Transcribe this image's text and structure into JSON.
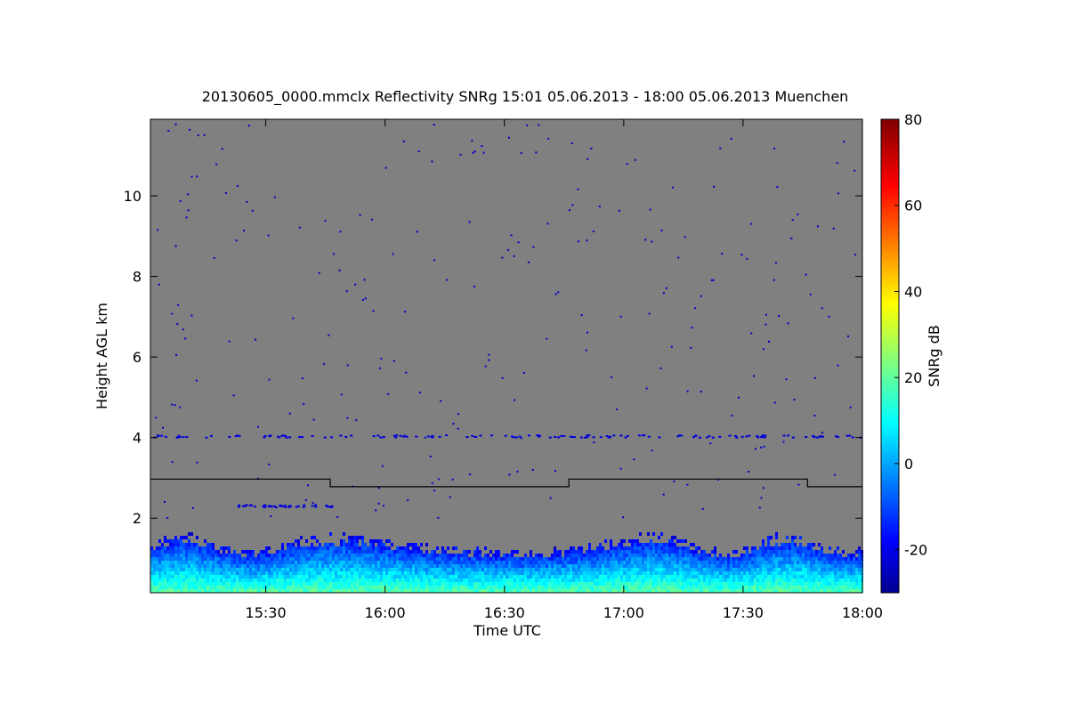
{
  "chart_data": {
    "type": "heatmap",
    "title": "20130605_0000.mmclx Reflectivity SNRg   15:01 05.06.2013 - 18:00 05.06.2013 Muenchen",
    "xlabel": "Time UTC",
    "ylabel": "Height AGL km",
    "colorbar_label": "SNRg dB",
    "x_range_hours": [
      15.0167,
      18.0
    ],
    "y_range_km": [
      0.15,
      11.9
    ],
    "x_ticks": [
      {
        "value": 15.5,
        "label": "15:30"
      },
      {
        "value": 16.0,
        "label": "16:00"
      },
      {
        "value": 16.5,
        "label": "16:30"
      },
      {
        "value": 17.0,
        "label": "17:00"
      },
      {
        "value": 17.5,
        "label": "17:30"
      },
      {
        "value": 18.0,
        "label": "18:00"
      }
    ],
    "y_ticks": [
      {
        "value": 2,
        "label": "2"
      },
      {
        "value": 4,
        "label": "4"
      },
      {
        "value": 6,
        "label": "6"
      },
      {
        "value": 8,
        "label": "8"
      },
      {
        "value": 10,
        "label": "10"
      }
    ],
    "colorbar_range": [
      -30,
      80
    ],
    "colorbar_ticks": [
      {
        "value": -20,
        "label": "-20"
      },
      {
        "value": 0,
        "label": "0"
      },
      {
        "value": 20,
        "label": "20"
      },
      {
        "value": 40,
        "label": "40"
      },
      {
        "value": 60,
        "label": "60"
      },
      {
        "value": 80,
        "label": "80"
      }
    ],
    "background_color": "#808080",
    "colormap": "jet",
    "boundary_line": [
      {
        "x": 15.0167,
        "y": 2.97
      },
      {
        "x": 15.77,
        "y": 2.97
      },
      {
        "x": 15.77,
        "y": 2.78
      },
      {
        "x": 16.77,
        "y": 2.78
      },
      {
        "x": 16.77,
        "y": 2.97
      },
      {
        "x": 17.77,
        "y": 2.97
      },
      {
        "x": 17.77,
        "y": 2.78
      },
      {
        "x": 18.0,
        "y": 2.78
      }
    ],
    "signal_layer": {
      "base_km": 0.15,
      "top_km_range": [
        1.2,
        1.7
      ],
      "snr_db_range": [
        -25,
        25
      ]
    },
    "aerosol_layers_km": [
      4.05,
      2.32
    ]
  }
}
